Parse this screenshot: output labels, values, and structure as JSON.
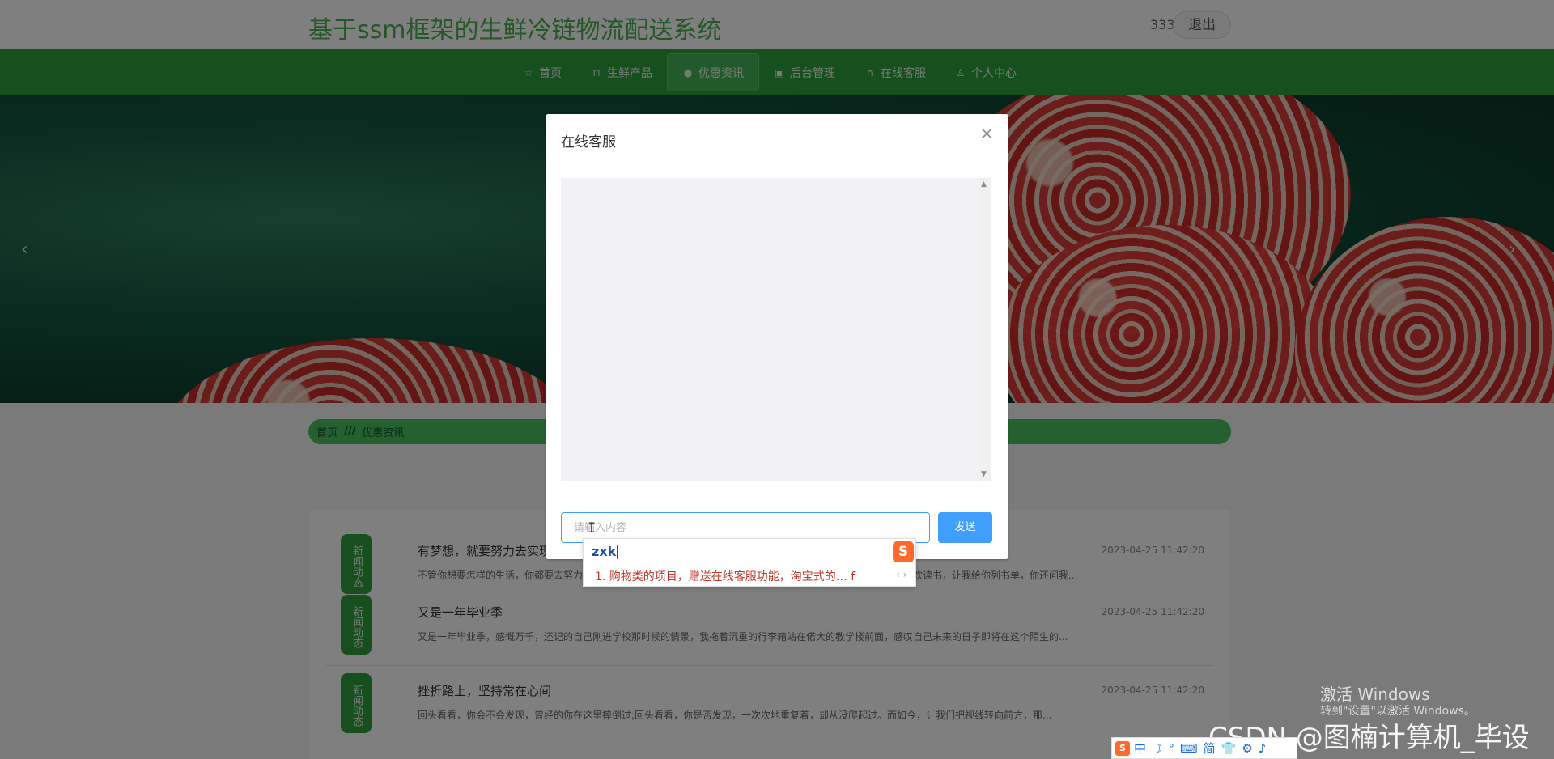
{
  "header": {
    "title": "基于ssm框架的生鲜冷链物流配送系统",
    "username": "333",
    "logout_label": "退出"
  },
  "nav": {
    "items": [
      {
        "label": "首页",
        "icon": "star-icon"
      },
      {
        "label": "生鲜产品",
        "icon": "bag-icon"
      },
      {
        "label": "优惠资讯",
        "icon": "info-icon",
        "active": true
      },
      {
        "label": "后台管理",
        "icon": "package-icon"
      },
      {
        "label": "在线客服",
        "icon": "headset-icon"
      },
      {
        "label": "个人中心",
        "icon": "user-icon"
      }
    ]
  },
  "banner": {
    "prev": "‹",
    "next": "›"
  },
  "breadcrumb": {
    "home": "首页",
    "separator": "///",
    "current": "优惠资讯"
  },
  "news": [
    {
      "badge": "新闻动态",
      "title": "有梦想，就要努力去实现",
      "date": "2023-04-25 11:42:20",
      "summary": "不管你想要怎样的生活，你都要去努力争取，不多尝试一些事情，你怎么知道自己适合什么、不适合什么？你说你喜欢读书，让我给你列书单，你还问我..."
    },
    {
      "badge": "新闻动态",
      "title": "又是一年毕业季",
      "date": "2023-04-25 11:42:20",
      "summary": "又是一年毕业季，感慨万千，还记的自己刚进学校那时候的情景，我拖着沉重的行李箱站在偌大的教学楼前面，感叹自己未来的日子即将在这个陌生的..."
    },
    {
      "badge": "新闻动态",
      "title": "挫折路上，坚持常在心间",
      "date": "2023-04-25 11:42:20",
      "summary": "回头看看，你会不会发现，曾经的你在这里摔倒过;回头看看，你是否发现，一次次地重复着，却从没爬起过。而如今，让我们把视线转向前方，那..."
    }
  ],
  "dialog": {
    "title": "在线客服",
    "close": "×",
    "input_placeholder": "请输入内容",
    "send_label": "发送"
  },
  "ime": {
    "composition": "zxk",
    "candidate": "1. 购物类的项目，赠送在线客服功能，淘宝式的… f",
    "arrows": "‹ ›",
    "logo": "S",
    "toolbar": [
      "中",
      "☽",
      "°",
      "⌨",
      "简",
      "👕",
      "⚙",
      "♪"
    ]
  },
  "watermarks": {
    "activate_title": "激活 Windows",
    "activate_sub": "转到\"设置\"以激活 Windows。",
    "csdn": "CSDN @图楠计算机_毕设"
  }
}
